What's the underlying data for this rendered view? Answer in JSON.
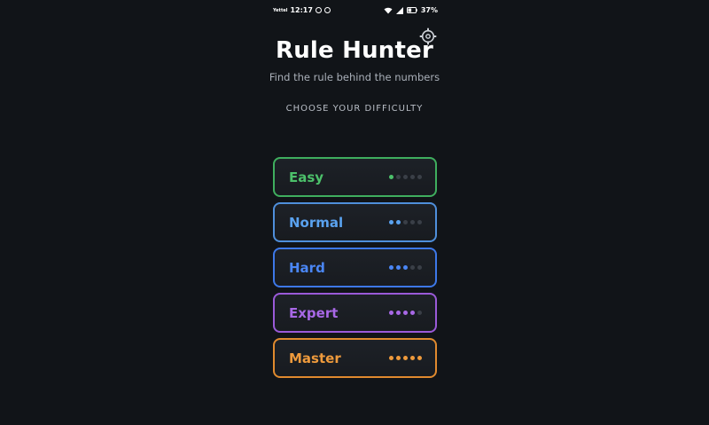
{
  "status_bar": {
    "carrier": "Yettel",
    "time": "12:17",
    "battery": "37%"
  },
  "header": {
    "title": "Rule Hunter",
    "subtitle": "Find the rule behind the numbers",
    "settings_icon": "gear-icon"
  },
  "section": {
    "label": "CHOOSE YOUR DIFFICULTY"
  },
  "difficulties": [
    {
      "label": "Easy",
      "level": 1,
      "max": 5,
      "color": "#4cc06a"
    },
    {
      "label": "Normal",
      "level": 2,
      "max": 5,
      "color": "#5aa2ef"
    },
    {
      "label": "Hard",
      "level": 3,
      "max": 5,
      "color": "#4a86f5"
    },
    {
      "label": "Expert",
      "level": 4,
      "max": 5,
      "color": "#a868e6"
    },
    {
      "label": "Master",
      "level": 5,
      "max": 5,
      "color": "#ee9a3c"
    }
  ]
}
